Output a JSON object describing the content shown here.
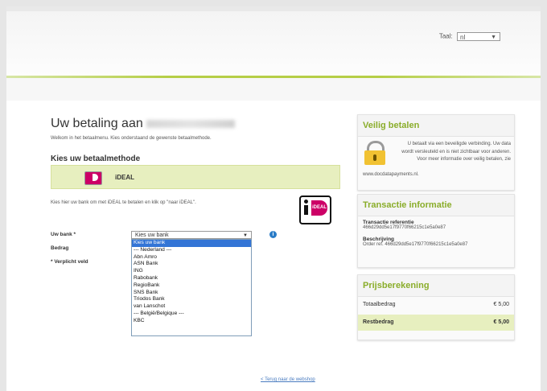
{
  "header": {
    "language_label": "Taal:",
    "language_value": "nl"
  },
  "main": {
    "title_prefix": "Uw betaling aan",
    "welcome_text": "Welkom in het betaalmenu. Kies onderstaand de gewenste betaalmethode.",
    "method_heading": "Kies uw betaalmethode",
    "method_label": "iDEAL",
    "ideal_logo_text": "iDEAL",
    "hint_text": "Kies hier uw bank om met iDEAL te betalen en klik op \"naar iDEAL\".",
    "bank_label": "Uw bank *",
    "amount_label": "Bedrag",
    "required_note": "* Verplicht veld",
    "bank_select_value": "Kies uw bank",
    "bank_options": [
      "Kies uw bank",
      "--- Nederland ---",
      "Abn Amro",
      "ASN Bank",
      "ING",
      "Rabobank",
      "RegioBank",
      "SNS Bank",
      "Triodos Bank",
      "van Lanschot",
      "--- België/Belgique ---",
      "KBC"
    ],
    "back_link": "< Terug naar de webshop"
  },
  "secure": {
    "title": "Veilig betalen",
    "text": "U betaalt via een beveiligde verbinding. Uw data wordt versleuteld en is niet zichtbaar voor anderen. Voor meer informatie over veilig betalen, zie",
    "link": "www.docdatapayments.nl."
  },
  "transaction": {
    "title": "Transactie informatie",
    "ref_label": "Transactie referentie",
    "ref_value": "466d29dd5e17f9770f66215c1e5a0e87",
    "desc_label": "Beschrijving",
    "desc_value": "Order ref. 466d29dd5e17f9770f66215c1e5a0e87"
  },
  "pricing": {
    "title": "Prijsberekening",
    "total_label": "Totaalbedrag",
    "total_value": "€ 5,00",
    "rest_label": "Restbedrag",
    "rest_value": "€ 5,00"
  },
  "colors": {
    "accent_green": "#8aad2a",
    "highlight_bg": "#e7efbf",
    "select_blue": "#3375d6",
    "info_blue": "#2a7cc7",
    "ideal_pink": "#cc0066"
  }
}
